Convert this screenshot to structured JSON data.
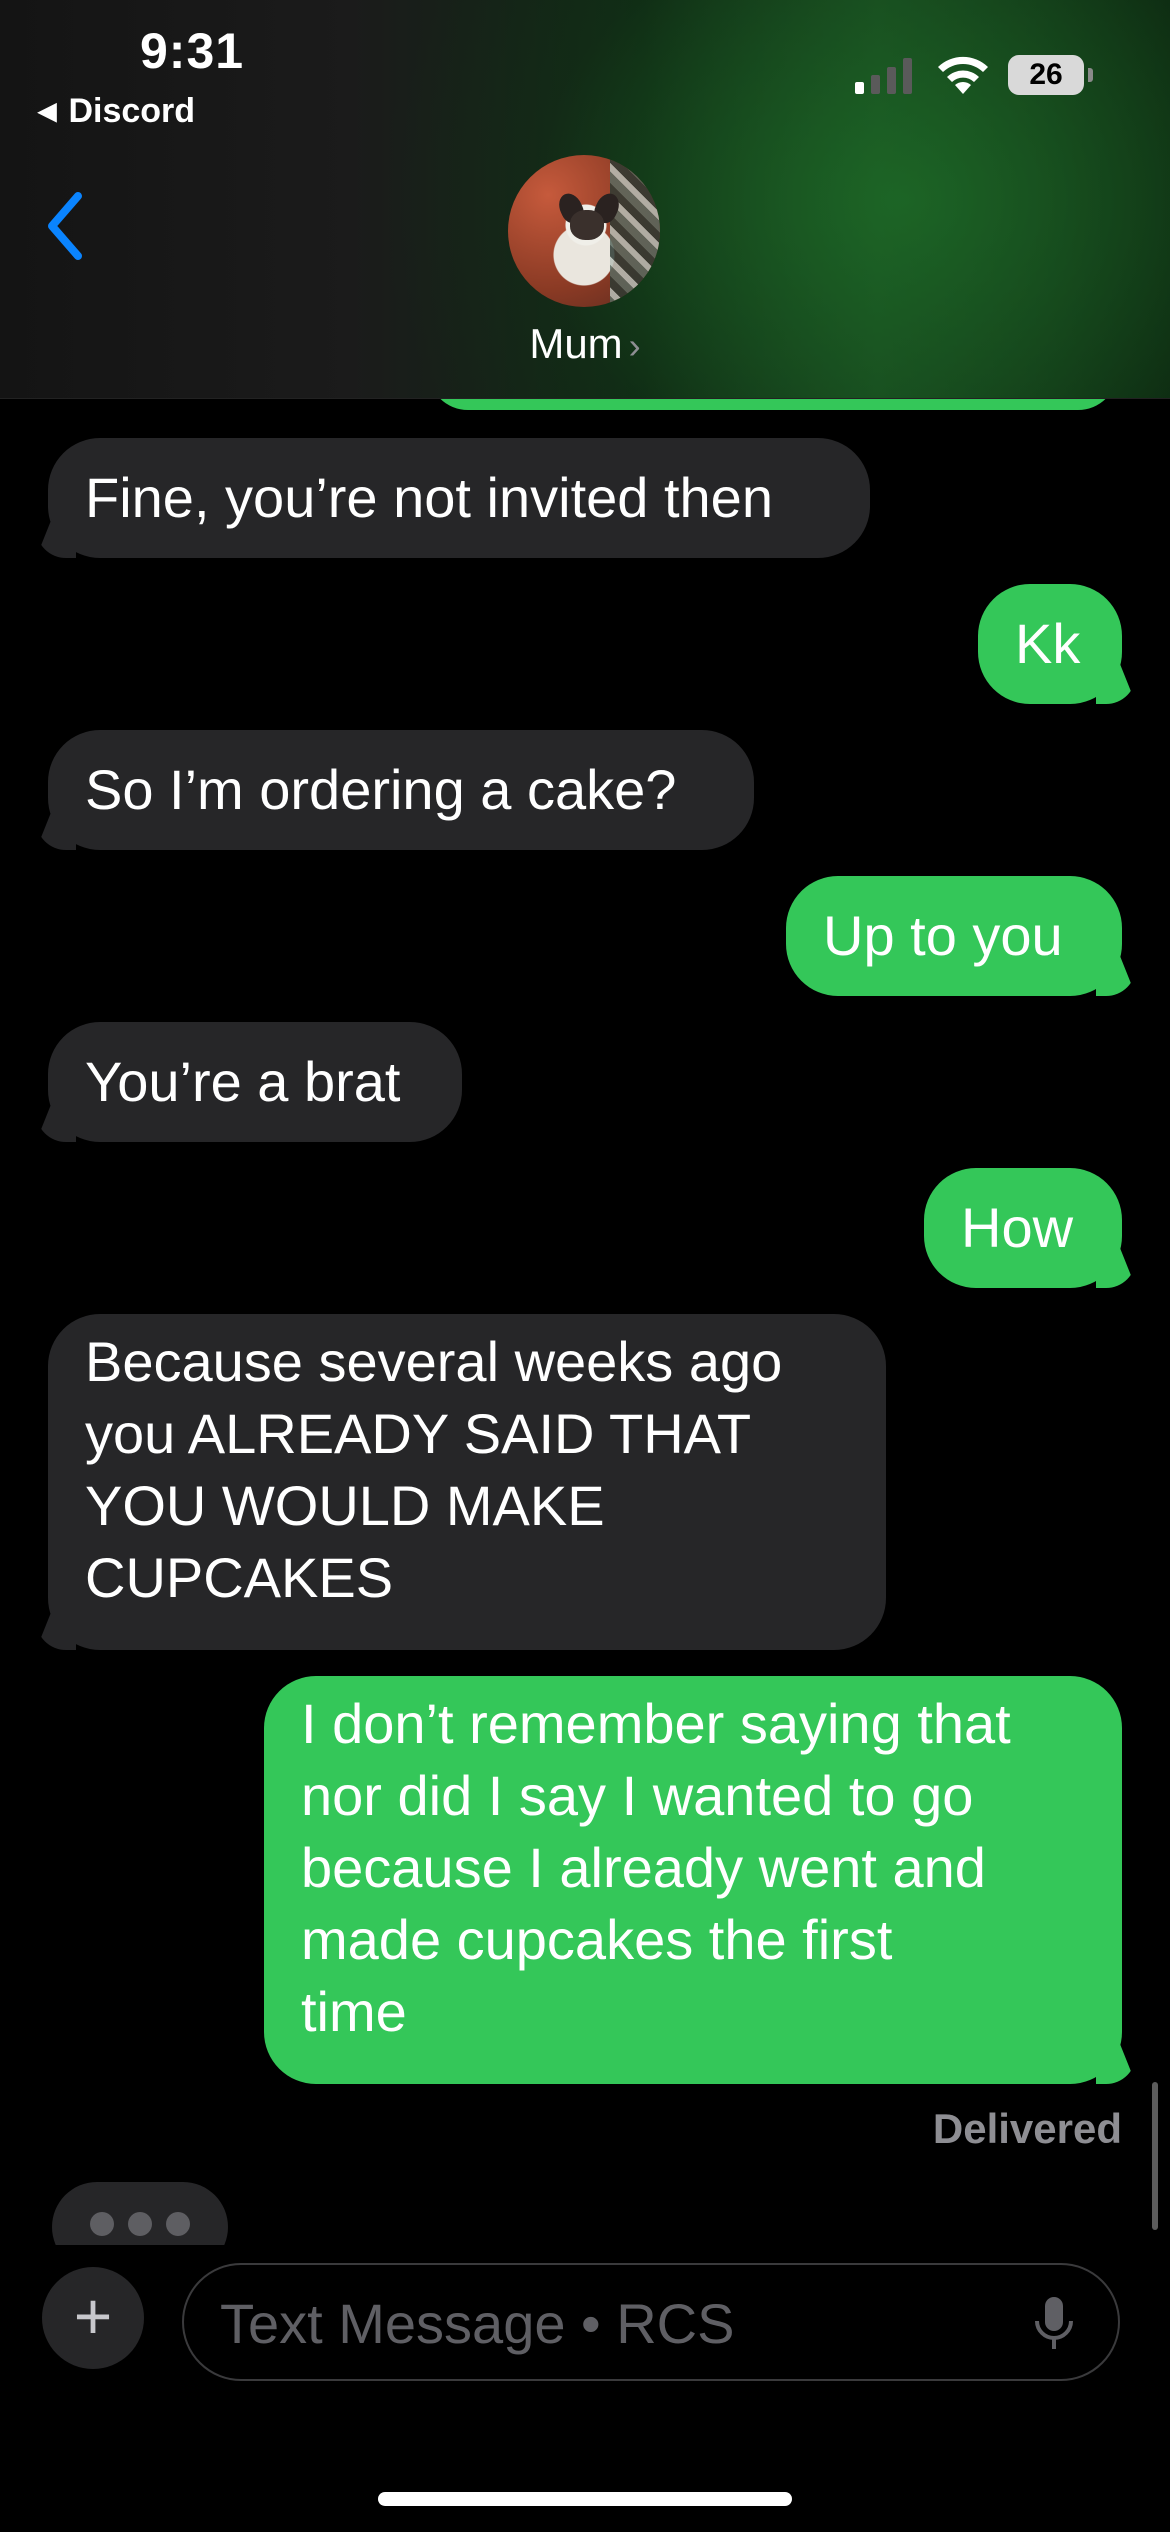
{
  "status_bar": {
    "time": "9:31",
    "back_app": "Discord",
    "battery": "26"
  },
  "header": {
    "contact_name": "Mum",
    "icons": [
      "back-chevron-icon",
      "avatar"
    ]
  },
  "messages": [
    {
      "dir": "in",
      "text": "Fine, you’re not invited then"
    },
    {
      "dir": "out",
      "text": "Kk"
    },
    {
      "dir": "in",
      "text": "So I’m ordering a cake?"
    },
    {
      "dir": "out",
      "text": "Up to you"
    },
    {
      "dir": "in",
      "text": "You’re a brat"
    },
    {
      "dir": "out",
      "text": "How"
    },
    {
      "dir": "in",
      "text": "Because several weeks ago you ALREADY SAID THAT YOU WOULD MAKE CUPCAKES",
      "lines": [
        "Because several weeks ago",
        "you ALREADY SAID THAT",
        "YOU WOULD MAKE",
        "CUPCAKES"
      ]
    },
    {
      "dir": "out",
      "text": "I don’t remember saying that nor did I say I wanted to go because I already went and made cupcakes the first time",
      "lines": [
        "I don’t remember saying that",
        "nor did I say I wanted to go",
        "because I already went and",
        "made cupcakes the first",
        "time"
      ]
    }
  ],
  "delivery_status": "Delivered",
  "composer": {
    "placeholder": "Text Message • RCS"
  },
  "colors": {
    "outgoing_bubble": "#34c759",
    "incoming_bubble": "#262628",
    "accent": "#0a84ff"
  }
}
